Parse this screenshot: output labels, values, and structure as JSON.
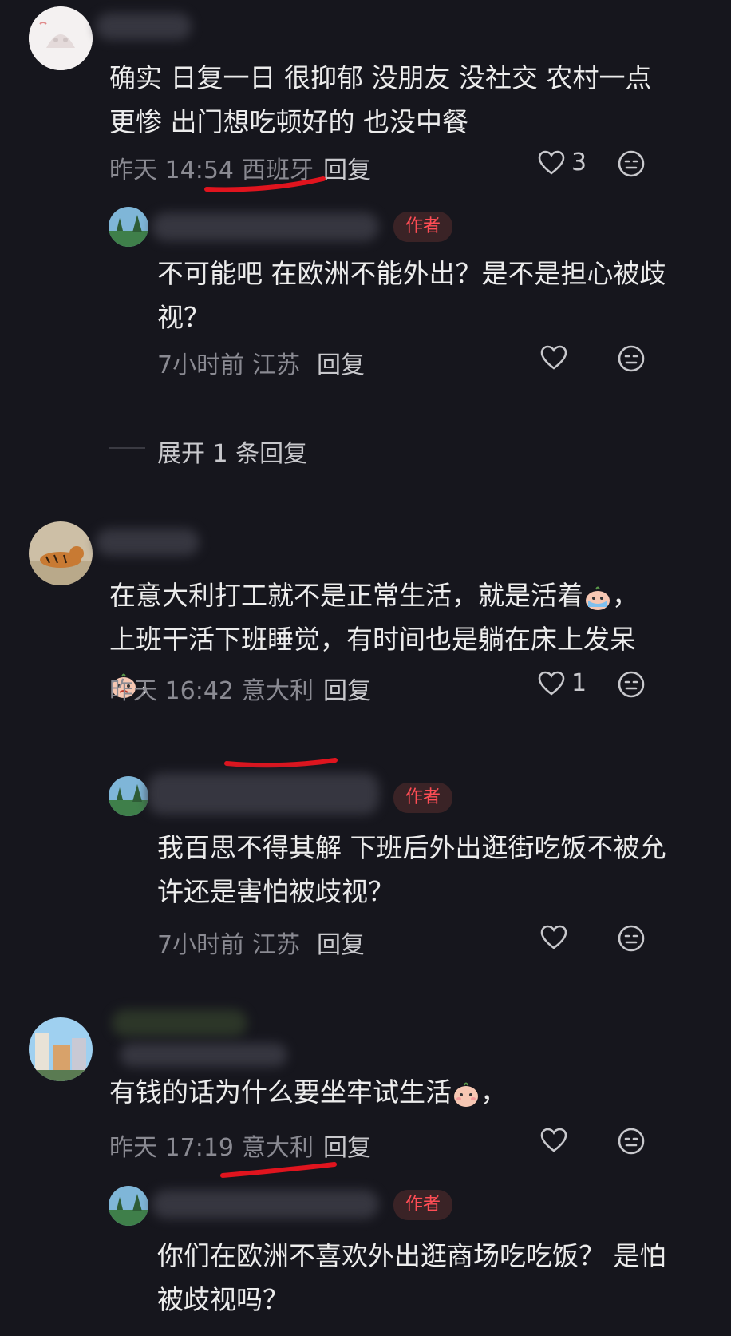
{
  "comments": [
    {
      "text": "确实 日复一日 很抑郁 没朋友 没社交 农村一点更惨 出门想吃顿好的 也没中餐",
      "time": "昨天 14:54",
      "location": "西班牙",
      "reply_label": "回复",
      "likes": "3",
      "replies": [
        {
          "badge": "作者",
          "text": "不可能吧 在欧洲不能外出？是不是担心被歧视？",
          "time": "7小时前",
          "location": "江苏",
          "reply_label": "回复"
        }
      ],
      "expand_label": "展开 1 条回复"
    },
    {
      "text_line1": "在意大利打工就不是正常生活，就是活着",
      "text_line1_end": "，",
      "text_line2": "上班干活下班睡觉，有时间也是躺在床上发呆",
      "text_line3_end": "，",
      "time": "昨天 16:42",
      "location": "意大利",
      "reply_label": "回复",
      "likes": "1",
      "replies": [
        {
          "badge": "作者",
          "text": "我百思不得其解 下班后外出逛街吃饭不被允许还是害怕被歧视？",
          "time": "7小时前",
          "location": "江苏",
          "reply_label": "回复"
        }
      ]
    },
    {
      "text": "有钱的话为什么要坐牢试生活",
      "text_end": "，",
      "time": "昨天 17:19",
      "location": "意大利",
      "reply_label": "回复",
      "replies": [
        {
          "badge": "作者",
          "text": "你们在欧洲不喜欢外出逛商场吃吃饭？ 是怕被歧视吗？"
        }
      ]
    }
  ],
  "icons": {
    "like": "heart-outline-icon",
    "dislike": "meh-face-icon"
  },
  "colors": {
    "background": "#16161d",
    "author_badge_text": "#ff4d55",
    "annotation_red": "#e0141e"
  }
}
